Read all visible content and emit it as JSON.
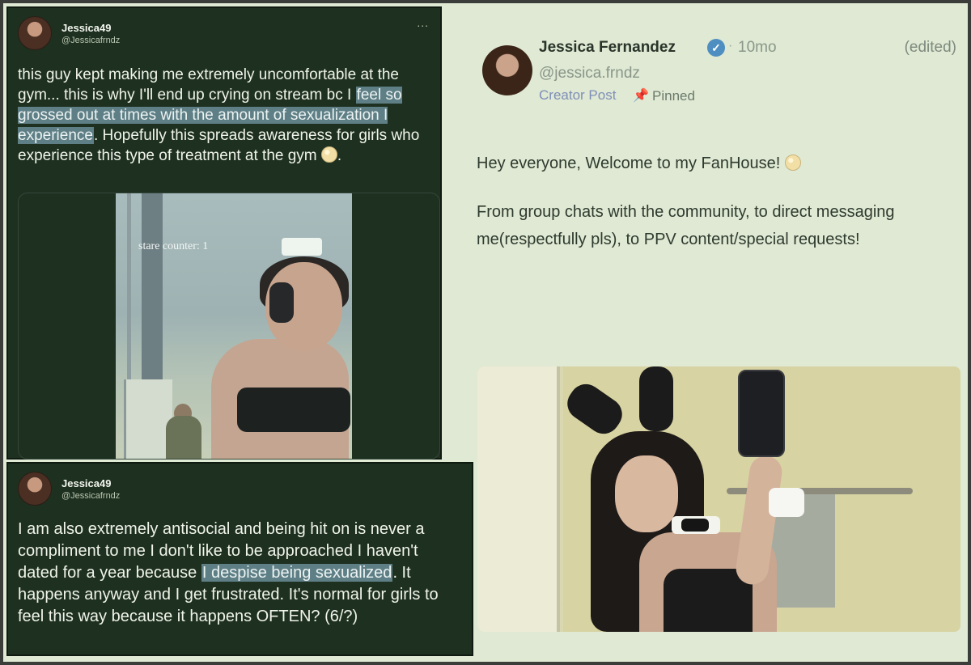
{
  "tweet1": {
    "name": "Jessica49",
    "handle": "@Jessicafrndz",
    "more": "...",
    "text_before": "this guy kept making me extremely uncomfortable at the gym... this is why I'll end up crying on stream bc I ",
    "text_highlight": "feel so grossed out at times with the amount of sexualization I experience",
    "text_after": ". Hopefully this spreads awareness for girls who experience this type of treatment at the gym",
    "text_end": ".",
    "video_overlay": "stare counter: 1"
  },
  "tweet2": {
    "name": "Jessica49",
    "handle": "@Jessicafrndz",
    "text_before": "I am also extremely antisocial and being hit on is never a compliment to me I don't like to be approached I haven't dated for a year because ",
    "text_highlight": "I despise being sexualized",
    "text_after": ". It happens anyway and I get frustrated. It's normal for girls to feel this way because it happens OFTEN? (6/?)"
  },
  "fanhouse": {
    "name": "Jessica Fernandez",
    "verified_icon": "✓",
    "separator": "·",
    "time": "10mo",
    "edited": "(edited)",
    "handle": "@jessica.frndz",
    "tag": "Creator Post",
    "pin_icon": "📌",
    "pinned": "Pinned",
    "para1": "Hey everyone, Welcome to my FanHouse!",
    "para2": "From group chats with the community, to direct messaging me(respectfully pls), to PPV content/special requests!"
  },
  "colors": {
    "tweet_bg": "#1e3020",
    "highlight": "#5f7f86",
    "page_bg": "#dfe9d3",
    "verified": "#4f8ec0",
    "creator_tag": "#7f8fb8"
  }
}
